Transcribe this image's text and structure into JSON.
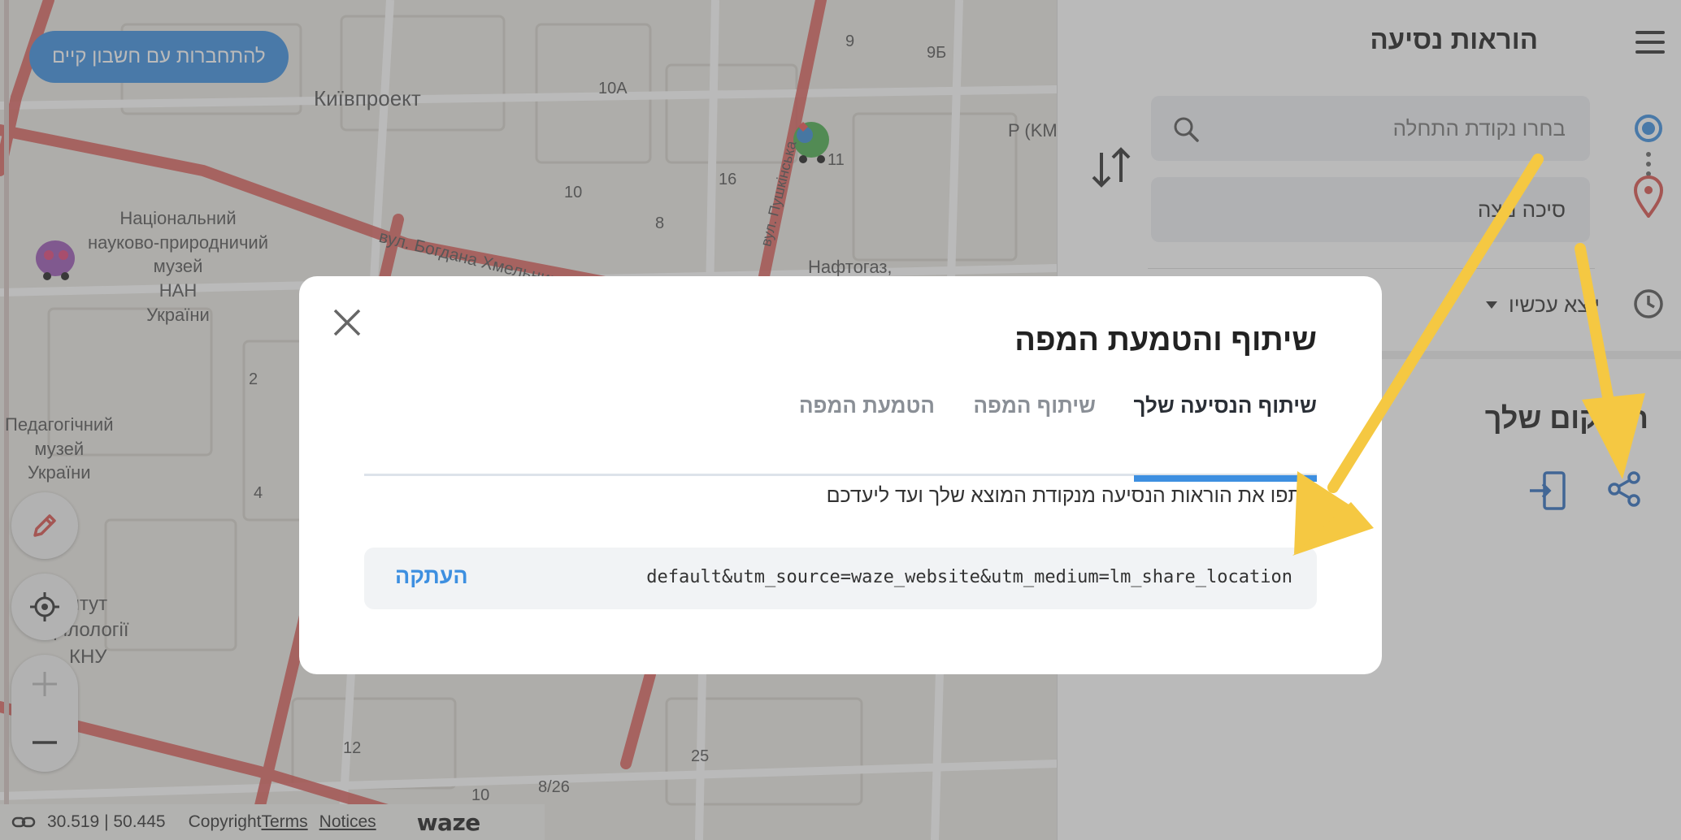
{
  "map": {
    "login_button": "להתחברות עם חשבון קיים",
    "district": "Київпроект",
    "museum": "Національний\nнауково-природничий\nмузей\nНАН\nУкраїни",
    "ped_museum": "Педагогічний\nмузей\nУкраїни",
    "institute": "итут\nфілології\nКНУ",
    "street1": "вул. Богдана Хмельницького",
    "street2": "вул. Пушкінська",
    "naftogaz": "Нафтогаз,",
    "rkm": "P (KM,",
    "numbers": [
      "9",
      "9Б",
      "10A",
      "11",
      "16",
      "10",
      "8",
      "2",
      "4",
      "12",
      "25",
      "8/26",
      "10"
    ],
    "coordinates": "30.519 | 50.445",
    "footer": {
      "copyright": "Copyright",
      "terms": "Terms",
      "notices": "Notices",
      "logo": "waze"
    }
  },
  "panel": {
    "title": "הוראות נסיעה",
    "start_placeholder": "בחרו נקודת התחלה",
    "destination": "סיכה נוצה",
    "depart": "יוצא עכשיו",
    "location_title": "המיקום שלך"
  },
  "modal": {
    "title": "שיתוף והטמעת המפה",
    "tabs": [
      {
        "label": "שיתוף הנסיעה שלך",
        "active": true
      },
      {
        "label": "שיתוף המפה",
        "active": false
      },
      {
        "label": "הטמעת המפה",
        "active": false
      }
    ],
    "description": "שתפו את הוראות הנסיעה מנקודת המוצא שלך ועד ליעדכם",
    "url": "default&utm_source=waze_website&utm_medium=lm_share_location",
    "copy_label": "העתקה"
  },
  "colors": {
    "accent": "#3d8fe0",
    "traffic": "#d9534f",
    "arrow": "#f5c842"
  }
}
